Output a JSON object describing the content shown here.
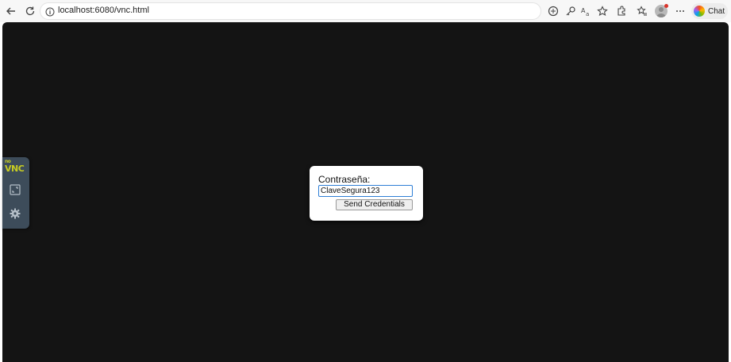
{
  "browser": {
    "url": "localhost:6080/vnc.html",
    "chat_label": "Chat",
    "icons": {
      "back": "back-arrow-icon",
      "refresh": "refresh-icon",
      "info": "info-icon",
      "tracking": "tracking-prevention-icon",
      "key": "key-icon",
      "translate": "translate-icon",
      "favorite": "favorite-star-icon",
      "extensions": "extensions-icon",
      "favorites": "favorites-list-icon",
      "profile": "profile-avatar",
      "more": "more-options-icon",
      "copilot": "copilot-icon"
    }
  },
  "vnc": {
    "background_color": "#141414",
    "control_bar": {
      "logo_small": "no",
      "logo_main": "VNC",
      "logo_color": "#c8cd21",
      "bar_color": "#3d4c5a"
    },
    "credentials_dialog": {
      "label": "Contraseña:",
      "password_value": "ClaveSegura123",
      "submit_label": "Send Credentials"
    }
  }
}
